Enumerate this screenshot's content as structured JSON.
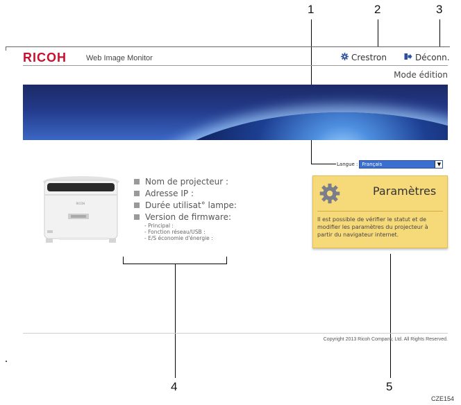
{
  "callouts": {
    "c1": "1",
    "c2": "2",
    "c3": "3",
    "c4": "4",
    "c5": "5"
  },
  "figure_code": "CZE154",
  "header": {
    "brand": "RICOH",
    "app_title": "Web Image Monitor",
    "crestron_label": "Crestron",
    "logout_label": "Déconn.",
    "mode_label": "Mode édition"
  },
  "language": {
    "label": "Langue :",
    "selected": "Français"
  },
  "info": {
    "projector_name": "Nom de projecteur :",
    "ip_address": "Adresse IP :",
    "lamp_time": "Durée utilisat° lampe:",
    "firmware": "Version de firmware:",
    "fw_main": "- Principal :",
    "fw_network": "- Fonction réseau/USB :",
    "fw_eco": "- E/S économie d'énergie :"
  },
  "settings_card": {
    "title": "Paramètres",
    "description": "Il est possible de vérifier le statut et de modifier les paramètres du projecteur à partir du navigateur internet."
  },
  "footer": {
    "copyright": "Copyright 2013 Ricoh Company, Ltd. All Rights Reserved."
  },
  "projector_image": {
    "brand_mark": "RICOH"
  },
  "colors": {
    "brand_red": "#c8102e",
    "card_bg": "#f6d979",
    "select_bg": "#3a6fd1"
  },
  "icons": {
    "crestron": "gear-icon",
    "logout": "logout-icon",
    "settings": "gear-icon"
  }
}
